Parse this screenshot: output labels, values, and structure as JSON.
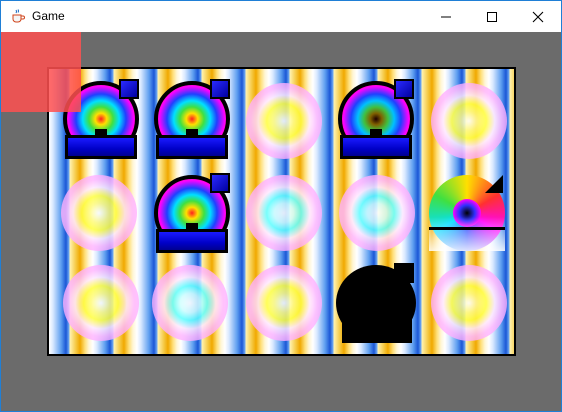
{
  "window": {
    "title": "Game",
    "icon": "java-cup-icon",
    "controls": [
      "minimize-icon",
      "maximize-icon",
      "close-icon"
    ]
  },
  "board": {
    "columns": 5,
    "rows": 3,
    "cells": [
      [
        "piece",
        "piece",
        "ghost",
        "piece-dim",
        "ghost"
      ],
      [
        "ghost",
        "piece",
        "ghost-cyan",
        "ghost-cyan",
        "tilted"
      ],
      [
        "ghost",
        "ghost-cyan",
        "ghost",
        "blob",
        "ghost"
      ]
    ]
  },
  "colors": {
    "background": "#6b6b6b",
    "overlay": "#ff5050",
    "pedestal": "#0000c8"
  }
}
